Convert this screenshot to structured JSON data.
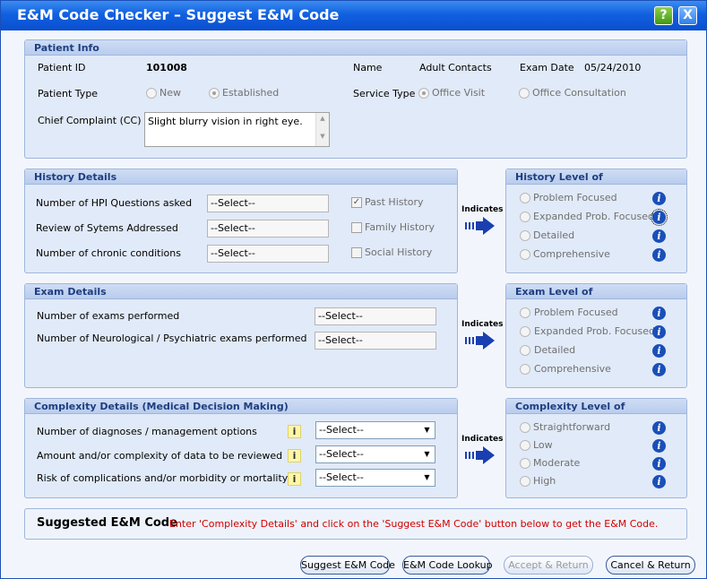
{
  "window": {
    "title": "E&M Code Checker – Suggest E&M Code",
    "help": "?",
    "close": "X"
  },
  "patient": {
    "header": "Patient Info",
    "id_label": "Patient ID",
    "id_value": "101008",
    "name_label": "Name",
    "name_value": "Adult Contacts",
    "exam_date_label": "Exam Date",
    "exam_date_value": "05/24/2010",
    "type_label": "Patient Type",
    "type_new": "New",
    "type_established": "Established",
    "service_label": "Service Type",
    "service_office_visit": "Office Visit",
    "service_consult": "Office Consultation",
    "cc_label": "Chief Complaint (CC)",
    "cc_value": "Slight blurry vision in right eye."
  },
  "history": {
    "header": "History Details",
    "rows": [
      {
        "label": "Number of HPI Questions asked",
        "value": "--Select--"
      },
      {
        "label": "Review of Sytems Addressed",
        "value": "--Select--"
      },
      {
        "label": "Number of chronic conditions",
        "value": "--Select--"
      }
    ],
    "checks": [
      {
        "label": "Past History",
        "checked": true
      },
      {
        "label": "Family History",
        "checked": false
      },
      {
        "label": "Social History",
        "checked": false
      }
    ]
  },
  "history_level": {
    "header": "History Level of",
    "items": [
      "Problem Focused",
      "Expanded Prob. Focused",
      "Detailed",
      "Comprehensive"
    ]
  },
  "exam": {
    "header": "Exam Details",
    "rows": [
      {
        "label": "Number of exams performed",
        "value": "--Select--"
      },
      {
        "label": "Number of Neurological / Psychiatric exams performed",
        "value": "--Select--"
      }
    ]
  },
  "exam_level": {
    "header": "Exam Level of",
    "items": [
      "Problem Focused",
      "Expanded Prob. Focused",
      "Detailed",
      "Comprehensive"
    ]
  },
  "complexity": {
    "header": "Complexity Details (Medical Decision Making)",
    "rows": [
      {
        "label": "Number of diagnoses / management options",
        "value": "--Select--"
      },
      {
        "label": "Amount and/or complexity of data to be reviewed",
        "value": "--Select--"
      },
      {
        "label": "Risk of complications and/or morbidity or mortality",
        "value": "--Select--"
      }
    ],
    "info_glyph": "i"
  },
  "complexity_level": {
    "header": "Complexity Level of",
    "items": [
      "Straightforward",
      "Low",
      "Moderate",
      "High"
    ]
  },
  "indicates": "Indicates",
  "suggested": {
    "title": "Suggested E&M Code",
    "message": "Enter 'Complexity Details' and click on the 'Suggest E&M Code' button below to get the E&M Code."
  },
  "buttons": {
    "suggest": "Suggest E&M Code",
    "lookup": "E&M Code Lookup",
    "accept": "Accept & Return",
    "cancel": "Cancel & Return"
  },
  "colors": {
    "title_bar": "#1160e0",
    "panel_header_text": "#1e3e80",
    "message": "#d00000",
    "info_icon": "#1a4fb8"
  }
}
